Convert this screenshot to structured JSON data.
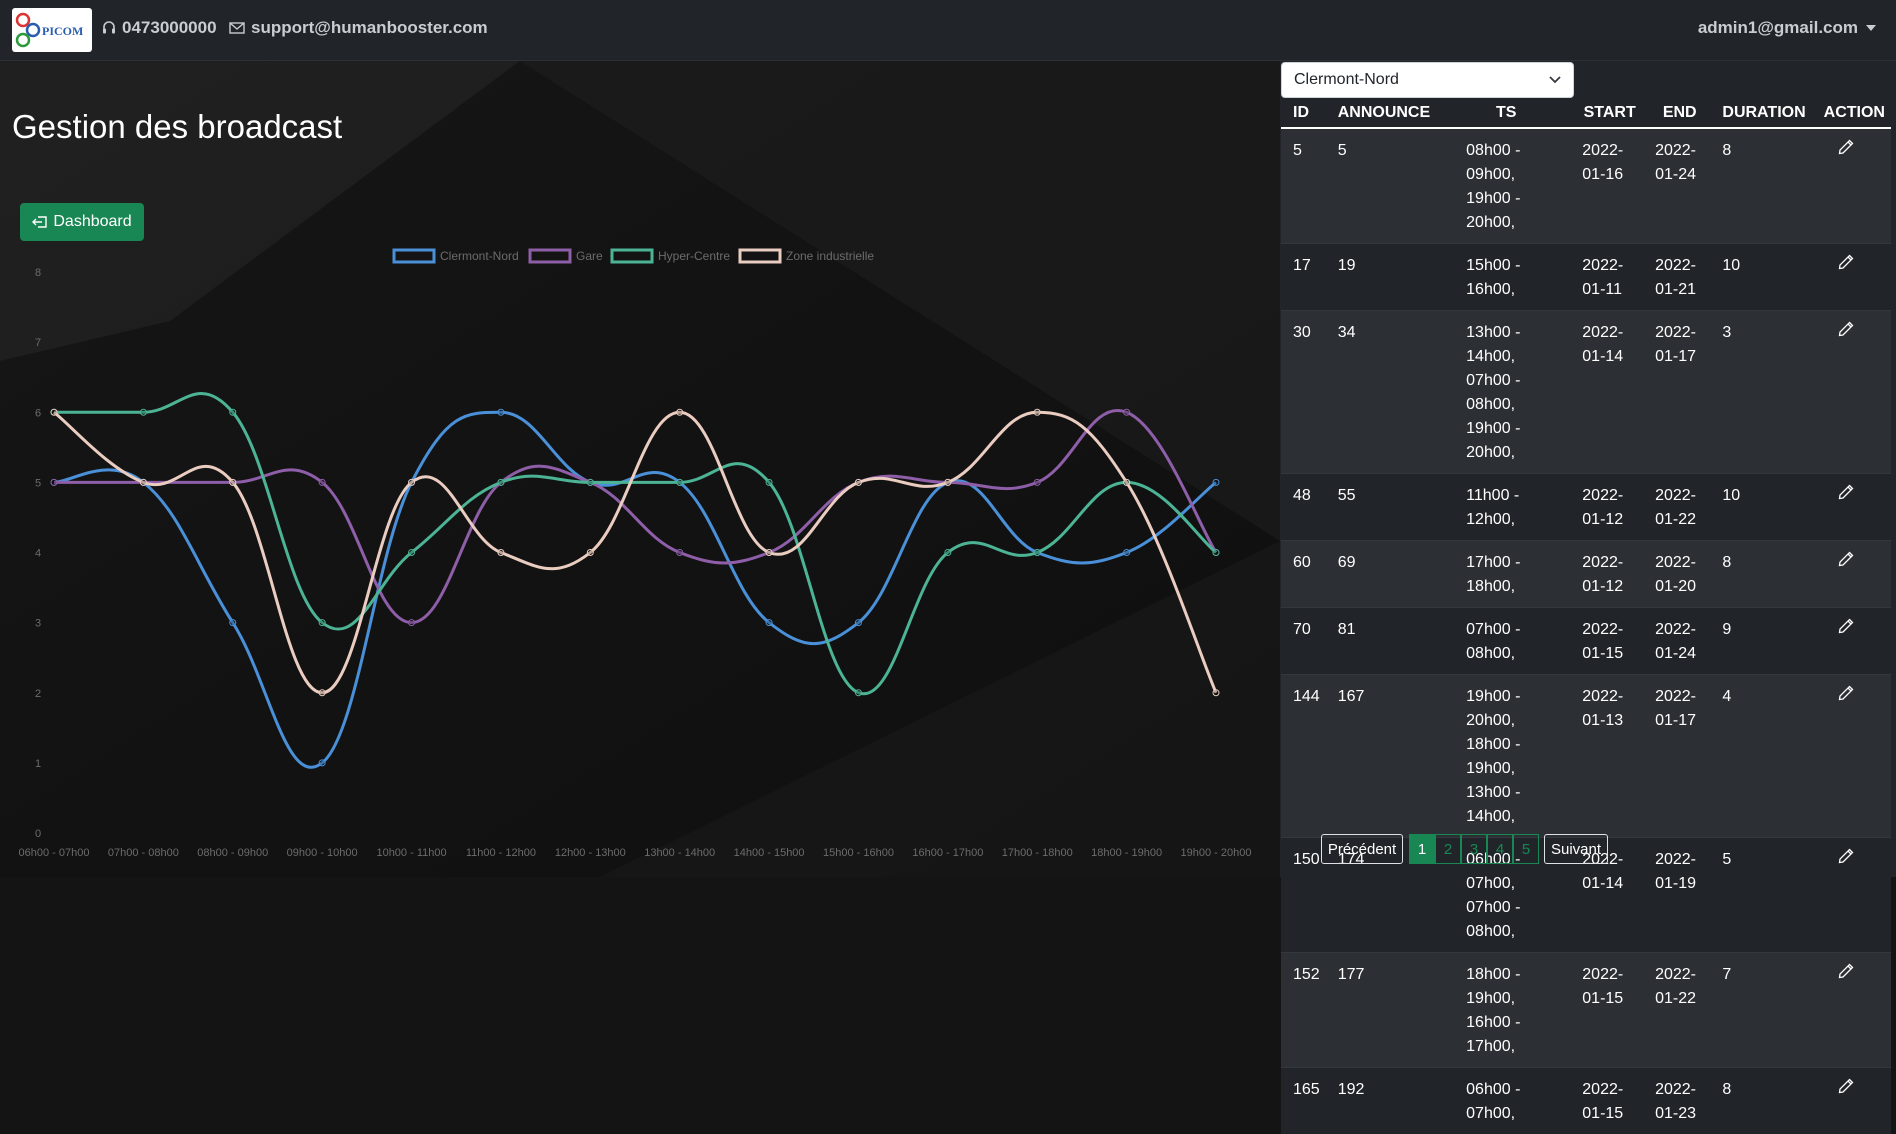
{
  "navbar": {
    "logo_text": "PICOM",
    "phone": "0473000000",
    "email": "support@humanbooster.com",
    "user": "admin1@gmail.com"
  },
  "page": {
    "title": "Gestion des broadcast",
    "dashboard_label": "Dashboard"
  },
  "zone_select": {
    "selected": "Clermont-Nord"
  },
  "table": {
    "headers": [
      "ID",
      "ANNOUNCE",
      "TS",
      "START",
      "END",
      "DURATION",
      "ACTION"
    ],
    "rows": [
      {
        "id": "5",
        "announce": "5",
        "ts": [
          "08h00 - 09h00,",
          "19h00 - 20h00,"
        ],
        "start": [
          "2022-",
          "01-16"
        ],
        "end": [
          "2022-",
          "01-24"
        ],
        "duration": "8"
      },
      {
        "id": "17",
        "announce": "19",
        "ts": [
          "15h00 - 16h00,"
        ],
        "start": [
          "2022-",
          "01-11"
        ],
        "end": [
          "2022-",
          "01-21"
        ],
        "duration": "10"
      },
      {
        "id": "30",
        "announce": "34",
        "ts": [
          "13h00 - 14h00,",
          "07h00 - 08h00,",
          "19h00 - 20h00,"
        ],
        "start": [
          "2022-",
          "01-14"
        ],
        "end": [
          "2022-",
          "01-17"
        ],
        "duration": "3"
      },
      {
        "id": "48",
        "announce": "55",
        "ts": [
          "11h00 - 12h00,"
        ],
        "start": [
          "2022-",
          "01-12"
        ],
        "end": [
          "2022-",
          "01-22"
        ],
        "duration": "10"
      },
      {
        "id": "60",
        "announce": "69",
        "ts": [
          "17h00 - 18h00,"
        ],
        "start": [
          "2022-",
          "01-12"
        ],
        "end": [
          "2022-",
          "01-20"
        ],
        "duration": "8"
      },
      {
        "id": "70",
        "announce": "81",
        "ts": [
          "07h00 - 08h00,"
        ],
        "start": [
          "2022-",
          "01-15"
        ],
        "end": [
          "2022-",
          "01-24"
        ],
        "duration": "9"
      },
      {
        "id": "144",
        "announce": "167",
        "ts": [
          "19h00 - 20h00,",
          "18h00 - 19h00,",
          "13h00 - 14h00,"
        ],
        "start": [
          "2022-",
          "01-13"
        ],
        "end": [
          "2022-",
          "01-17"
        ],
        "duration": "4"
      },
      {
        "id": "150",
        "announce": "174",
        "ts": [
          "06h00 - 07h00,",
          "07h00 - 08h00,"
        ],
        "start": [
          "2022-",
          "01-14"
        ],
        "end": [
          "2022-",
          "01-19"
        ],
        "duration": "5"
      },
      {
        "id": "152",
        "announce": "177",
        "ts": [
          "18h00 - 19h00,",
          "16h00 - 17h00,"
        ],
        "start": [
          "2022-",
          "01-15"
        ],
        "end": [
          "2022-",
          "01-22"
        ],
        "duration": "7"
      },
      {
        "id": "165",
        "announce": "192",
        "ts": [
          "06h00 - 07h00,"
        ],
        "start": [
          "2022-",
          "01-15"
        ],
        "end": [
          "2022-",
          "01-23"
        ],
        "duration": "8"
      }
    ]
  },
  "pagination": {
    "prev": "Précédent",
    "pages": [
      "1",
      "2",
      "3",
      "4",
      "5"
    ],
    "active": "1",
    "next": "Suivant"
  },
  "colors": {
    "accent_green": "#198754",
    "series": [
      "#4a90d9",
      "#8e5ea8",
      "#4cb495",
      "#eacdc0"
    ]
  },
  "chart_data": {
    "type": "line",
    "categories": [
      "06h00 - 07h00",
      "07h00 - 08h00",
      "08h00 - 09h00",
      "09h00 - 10h00",
      "10h00 - 11h00",
      "11h00 - 12h00",
      "12h00 - 13h00",
      "13h00 - 14h00",
      "14h00 - 15h00",
      "15h00 - 16h00",
      "16h00 - 17h00",
      "17h00 - 18h00",
      "18h00 - 19h00",
      "19h00 - 20h00"
    ],
    "series": [
      {
        "name": "Clermont-Nord",
        "values": [
          5,
          5,
          3,
          1,
          5,
          6,
          5,
          5,
          3,
          3,
          5,
          4,
          4,
          5
        ]
      },
      {
        "name": "Gare",
        "values": [
          5,
          5,
          5,
          5,
          3,
          5,
          5,
          4,
          4,
          5,
          5,
          5,
          6,
          4
        ]
      },
      {
        "name": "Hyper-Centre",
        "values": [
          6,
          6,
          6,
          3,
          4,
          5,
          5,
          5,
          5,
          2,
          4,
          4,
          5,
          4
        ]
      },
      {
        "name": "Zone industrielle",
        "values": [
          6,
          5,
          5,
          2,
          5,
          4,
          4,
          6,
          4,
          5,
          5,
          6,
          5,
          2
        ]
      }
    ],
    "ylim": [
      0,
      8
    ],
    "yticks": [
      "0",
      "1",
      "2",
      "3",
      "4",
      "5",
      "6",
      "7",
      "8"
    ],
    "legend": "top",
    "grid": false
  }
}
